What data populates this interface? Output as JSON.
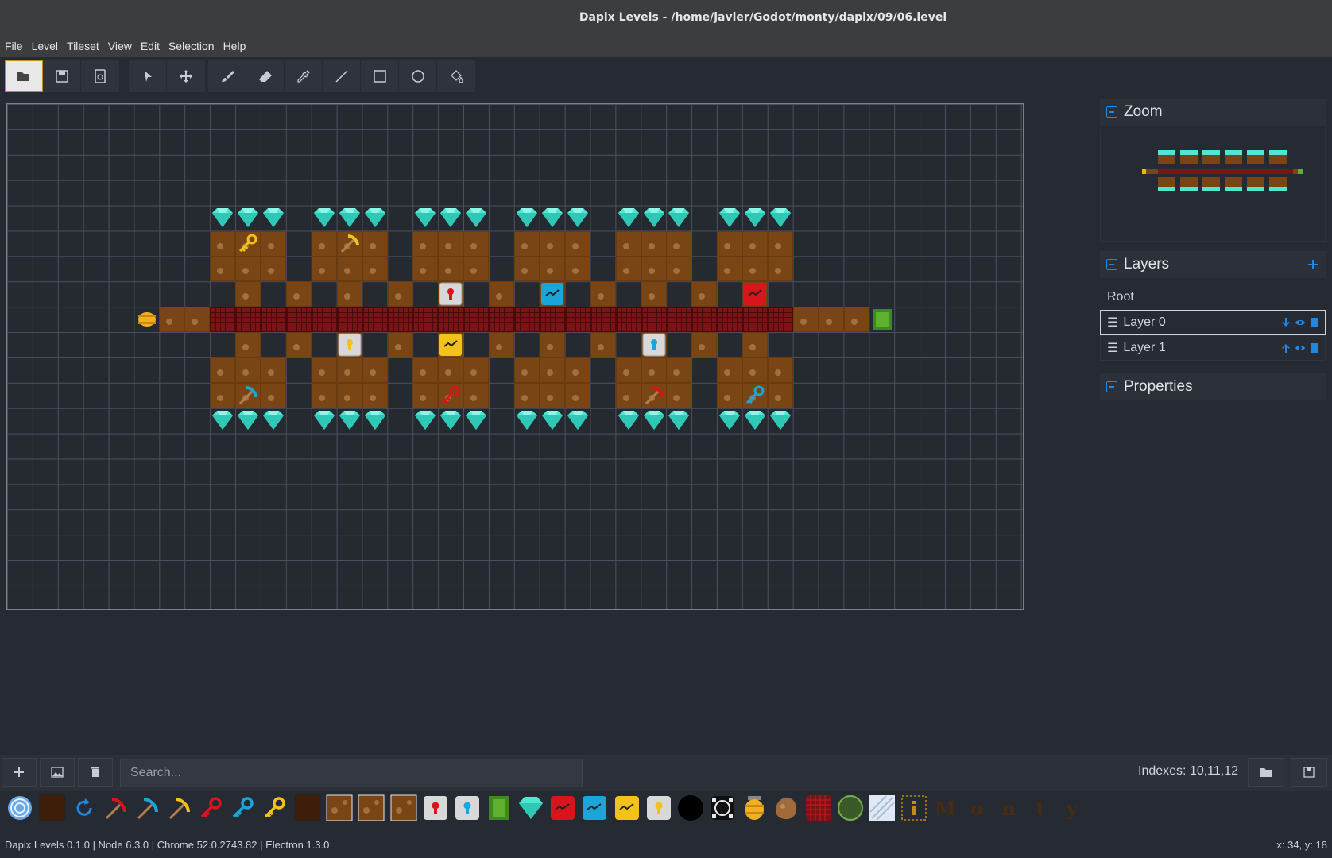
{
  "window": {
    "title": "Dapix Levels - /home/javier/Godot/monty/dapix/09/06.level"
  },
  "menu": [
    "File",
    "Level",
    "Tileset",
    "View",
    "Edit",
    "Selection",
    "Help"
  ],
  "toolbar": {
    "file_tools": [
      "open-folder-icon",
      "save-icon",
      "save-as-icon"
    ],
    "select_tools": [
      "pointer-icon",
      "move-icon"
    ],
    "draw_tools": [
      "brush-icon",
      "eraser-icon",
      "eyedropper-icon",
      "line-icon",
      "rectangle-icon",
      "circle-icon",
      "fill-bucket-icon"
    ]
  },
  "right_panel": {
    "zoom_title": "Zoom",
    "layers_title": "Layers",
    "layers": [
      {
        "label": "Root"
      },
      {
        "label": "Layer 0",
        "selected": true
      },
      {
        "label": "Layer 1"
      }
    ],
    "properties_title": "Properties"
  },
  "bottom": {
    "search_placeholder": "Search...",
    "indexes_text": "Indexes: 10,11,12"
  },
  "palette": {
    "tiles": [
      "spiral-icon",
      "dark-dirt-icon",
      "rotate-icon",
      "red-pickaxe-icon",
      "blue-pickaxe-icon",
      "yellow-pickaxe-icon",
      "red-key-icon",
      "blue-key-icon",
      "yellow-key-icon",
      "dark-dirt-icon",
      "dirt-icon",
      "dirt-icon",
      "dirt-icon",
      "red-lock-icon",
      "blue-lock-icon",
      "green-exit-icon",
      "diamond-icon",
      "red-door-icon",
      "blue-door-icon",
      "yellow-door-icon",
      "yellow-lock-icon",
      "black-hole-icon",
      "cross-icon",
      "barrel-icon",
      "rock-icon",
      "red-grid-icon",
      "green-orb-icon",
      "ice-icon",
      "info-icon"
    ],
    "letters": [
      "M",
      "o",
      "n",
      "t",
      "y"
    ]
  },
  "status": {
    "left": "Dapix Levels 0.1.0 | Node 6.3.0 | Chrome 52.0.2743.82 | Electron 1.3.0",
    "right": "x: 34, y: 18"
  },
  "colors": {
    "accent": "#1e88e5",
    "dirt": "#7a4514",
    "bridge": "#7a1416",
    "diamond": "#4ee8d2"
  }
}
